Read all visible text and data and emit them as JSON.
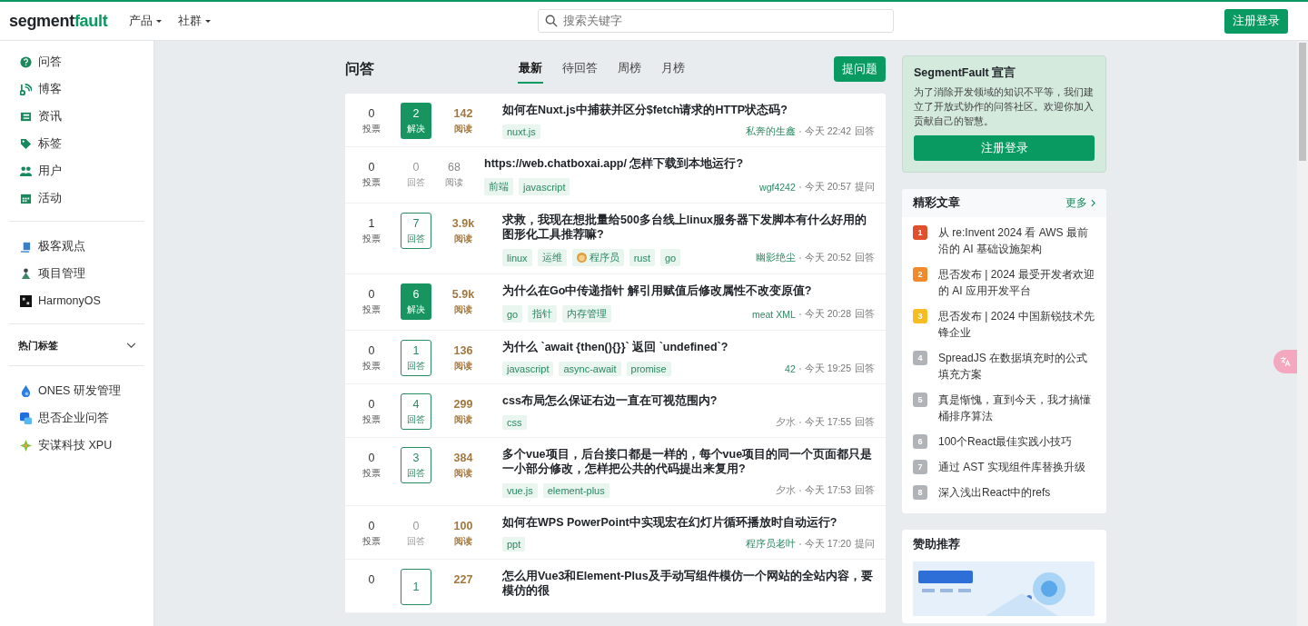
{
  "header": {
    "logo": {
      "dark": "segment",
      "accent": "fault"
    },
    "menus": [
      "产品",
      "社群"
    ],
    "search": {
      "placeholder": "搜索关键字"
    },
    "register_button": "注册登录"
  },
  "sidebar": {
    "groups": [
      [
        {
          "label": "问答",
          "kind": "question"
        },
        {
          "label": "博客",
          "kind": "feed"
        },
        {
          "label": "资讯",
          "kind": "news"
        },
        {
          "label": "标签",
          "kind": "tag"
        },
        {
          "label": "用户",
          "kind": "users"
        },
        {
          "label": "活动",
          "kind": "calendar"
        }
      ],
      [
        {
          "label": "极客观点",
          "kind": "geek"
        },
        {
          "label": "项目管理",
          "kind": "project"
        },
        {
          "label": "HarmonyOS",
          "kind": "square"
        }
      ]
    ],
    "hot_tags": {
      "label": "热门标签",
      "expanded": false
    },
    "partners": [
      {
        "label": "ONES 研发管理",
        "kind": "drop"
      },
      {
        "label": "思否企业问答",
        "kind": "chat"
      },
      {
        "label": "安谋科技 XPU",
        "kind": "star"
      }
    ]
  },
  "main": {
    "title": "问答",
    "tabs": [
      {
        "label": "最新",
        "selected": true
      },
      {
        "label": "待回答",
        "selected": false
      },
      {
        "label": "周榜",
        "selected": false
      },
      {
        "label": "月榜",
        "selected": false
      }
    ],
    "ask_button": "提问题",
    "questions": [
      {
        "votes": "0",
        "votes_label": "投票",
        "answers": "2",
        "answers_label": "解决",
        "kind": "solved",
        "views": "142",
        "views_label": "阅读",
        "hot": true,
        "title": "如何在Nuxt.js中捕获并区分$fetch请求的HTTP状态码?",
        "tags": [
          {
            "label": "nuxt.js",
            "has_icon": false
          }
        ],
        "author": "私奔的生鑫",
        "author_highlighted": true,
        "time": "今天 22:42",
        "action": "回答"
      },
      {
        "votes": "0",
        "votes_label": "投票",
        "answers": "0",
        "answers_label": "回答",
        "kind": "none",
        "views": "68",
        "views_label": "阅读",
        "hot": false,
        "title": "https://web.chatboxai.app/ 怎样下载到本地运行?",
        "tags": [
          {
            "label": "前端",
            "has_icon": false
          },
          {
            "label": "javascript",
            "has_icon": false
          }
        ],
        "author": "wgf4242",
        "author_highlighted": true,
        "time": "今天 20:57",
        "action": "提问"
      },
      {
        "votes": "1",
        "votes_label": "投票",
        "answers": "7",
        "answers_label": "回答",
        "kind": "answered",
        "views": "3.9k",
        "views_label": "阅读",
        "hot": true,
        "title": "求救，我现在想批量给500多台线上linux服务器下发脚本有什么好用的图形化工具推荐嘛?",
        "tags": [
          {
            "label": "linux",
            "has_icon": false
          },
          {
            "label": "运维",
            "has_icon": false
          },
          {
            "label": "程序员",
            "has_icon": true
          },
          {
            "label": "rust",
            "has_icon": false
          },
          {
            "label": "go",
            "has_icon": false
          }
        ],
        "author": "幽影绝尘",
        "author_highlighted": true,
        "time": "今天 20:52",
        "action": "回答"
      },
      {
        "votes": "0",
        "votes_label": "投票",
        "answers": "6",
        "answers_label": "解决",
        "kind": "solved",
        "views": "5.9k",
        "views_label": "阅读",
        "hot": true,
        "title": "为什么在Go中传递指针 解引用赋值后修改属性不改变原值?",
        "tags": [
          {
            "label": "go",
            "has_icon": false
          },
          {
            "label": "指针",
            "has_icon": false
          },
          {
            "label": "内存管理",
            "has_icon": false
          }
        ],
        "author": "meat XML",
        "author_highlighted": true,
        "time": "今天 20:28",
        "action": "回答"
      },
      {
        "votes": "0",
        "votes_label": "投票",
        "answers": "1",
        "answers_label": "回答",
        "kind": "answered",
        "views": "136",
        "views_label": "阅读",
        "hot": true,
        "title": "为什么 `await {then(){}}` 返回 `undefined`?",
        "tags": [
          {
            "label": "javascript",
            "has_icon": false
          },
          {
            "label": "async-await",
            "has_icon": false
          },
          {
            "label": "promise",
            "has_icon": false
          }
        ],
        "author": "42",
        "author_highlighted": true,
        "time": "今天 19:25",
        "action": "回答"
      },
      {
        "votes": "0",
        "votes_label": "投票",
        "answers": "4",
        "answers_label": "回答",
        "kind": "answered",
        "views": "299",
        "views_label": "阅读",
        "hot": true,
        "title": "css布局怎么保证右边一直在可视范围内?",
        "tags": [
          {
            "label": "css",
            "has_icon": false
          }
        ],
        "author": "夕水",
        "author_highlighted": false,
        "time": "今天 17:55",
        "action": "回答"
      },
      {
        "votes": "0",
        "votes_label": "投票",
        "answers": "3",
        "answers_label": "回答",
        "kind": "answered",
        "views": "384",
        "views_label": "阅读",
        "hot": true,
        "title": "多个vue项目，后台接口都是一样的，每个vue项目的同一个页面都只是一小部分修改，怎样把公共的代码提出来复用?",
        "tags": [
          {
            "label": "vue.js",
            "has_icon": false
          },
          {
            "label": "element-plus",
            "has_icon": false
          }
        ],
        "author": "夕水",
        "author_highlighted": false,
        "time": "今天 17:53",
        "action": "回答"
      },
      {
        "votes": "0",
        "votes_label": "投票",
        "answers": "0",
        "answers_label": "回答",
        "kind": "none",
        "views": "100",
        "views_label": "阅读",
        "hot": true,
        "title": "如何在WPS PowerPoint中实现宏在幻灯片循环播放时自动运行?",
        "tags": [
          {
            "label": "ppt",
            "has_icon": false
          }
        ],
        "author": "程序员老叶",
        "author_highlighted": true,
        "time": "今天 17:20",
        "action": "提问"
      },
      {
        "votes": "0",
        "answers": "1",
        "kind": "answered",
        "views": "227",
        "hot": true,
        "title": "怎么用Vue3和Element-Plus及手动写组件模仿一个网站的全站内容，要模仿的很"
      }
    ]
  },
  "aside": {
    "manifesto": {
      "title": "SegmentFault 宣言",
      "text": "为了消除开发领域的知识不平等，我们建立了开放式协作的问答社区。欢迎你加入贡献自己的智慧。",
      "button": "注册登录"
    },
    "articles": {
      "title": "精彩文章",
      "more": "更多",
      "items": [
        {
          "rank": "1",
          "color": "#e0502c",
          "title": "从 re:Invent 2024 看 AWS 最前沿的 AI 基础设施架构"
        },
        {
          "rank": "2",
          "color": "#f08a2c",
          "title": "思否发布 | 2024 最受开发者欢迎的 AI 应用开发平台"
        },
        {
          "rank": "3",
          "color": "#f5bd22",
          "title": "思否发布 | 2024 中国新锐技术先锋企业"
        },
        {
          "rank": "4",
          "color": "#b0b4b8",
          "title": "SpreadJS 在数据填充时的公式填充方案"
        },
        {
          "rank": "5",
          "color": "#b0b4b8",
          "title": "真是惭愧，直到今天，我才搞懂桶排序算法"
        },
        {
          "rank": "6",
          "color": "#b0b4b8",
          "title": "100个React最佳实践小技巧"
        },
        {
          "rank": "7",
          "color": "#b0b4b8",
          "title": "通过 AST 实现组件库替换升级"
        },
        {
          "rank": "8",
          "color": "#b0b4b8",
          "title": "深入浅出React中的refs"
        }
      ]
    },
    "sponsor": {
      "title": "赞助推荐"
    }
  }
}
